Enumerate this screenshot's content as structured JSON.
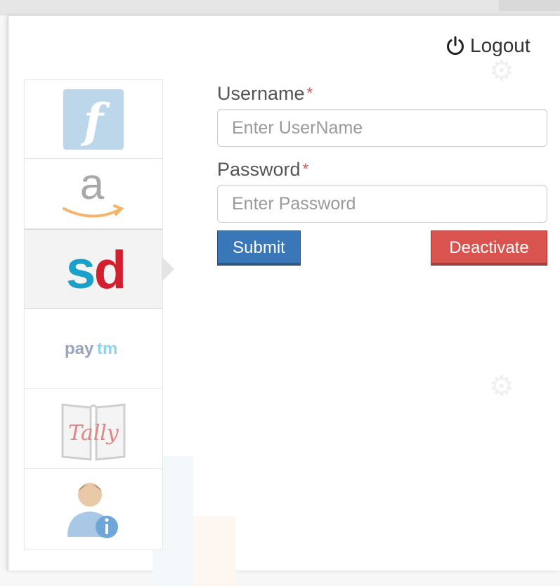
{
  "header": {
    "logout_label": "Logout",
    "logout_icon": "power-icon"
  },
  "sidebar": {
    "items": [
      {
        "name": "freshbooks",
        "icon": "freshbooks-logo",
        "color": "#6fa7d6"
      },
      {
        "name": "amazon",
        "icon": "amazon-logo",
        "color": "#f2a03a"
      },
      {
        "name": "snapdeal",
        "icon": "snapdeal-logo",
        "color": "#d3202f",
        "active": true
      },
      {
        "name": "paytm",
        "icon": "paytm-logo",
        "text": "paytm",
        "color": "#20baf2"
      },
      {
        "name": "tally",
        "icon": "tally-logo",
        "text": "Tally",
        "color": "#d34c4c"
      },
      {
        "name": "user-info",
        "icon": "user-info-icon",
        "color": "#4a8fd0"
      }
    ]
  },
  "form": {
    "username_label": "Username",
    "username_placeholder": "Enter UserName",
    "username_value": "",
    "password_label": "Password",
    "password_placeholder": "Enter Password",
    "password_value": "",
    "required_marker": "*",
    "submit_label": "Submit",
    "deactivate_label": "Deactivate"
  },
  "colors": {
    "submit": "#3a77b8",
    "deactivate": "#d9534f",
    "required": "#d9534f"
  }
}
